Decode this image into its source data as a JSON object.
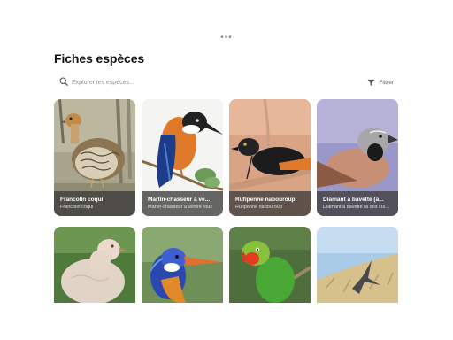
{
  "header": {
    "more_icon": "ellipsis-icon",
    "more_label": "•••",
    "title": "Fiches espèces"
  },
  "search": {
    "placeholder": "Explorer les espèces...",
    "value": "",
    "icon": "search-icon"
  },
  "filter": {
    "label": "Filtrer",
    "icon": "filter-icon"
  },
  "cards": [
    {
      "name": "Francolin coqui",
      "subtitle": "Francolin coqui"
    },
    {
      "name": "Martin-chasseur à ve...",
      "subtitle": "Martin-chasseur à ventre roux"
    },
    {
      "name": "Rufipenne nabouroup",
      "subtitle": "Rufipenne nabouroup"
    },
    {
      "name": "Diamant à bavette (à...",
      "subtitle": "Diamant à bavette (à dos cuivré)"
    },
    {
      "name": "",
      "subtitle": ""
    },
    {
      "name": "",
      "subtitle": ""
    },
    {
      "name": "",
      "subtitle": ""
    },
    {
      "name": "",
      "subtitle": ""
    }
  ]
}
